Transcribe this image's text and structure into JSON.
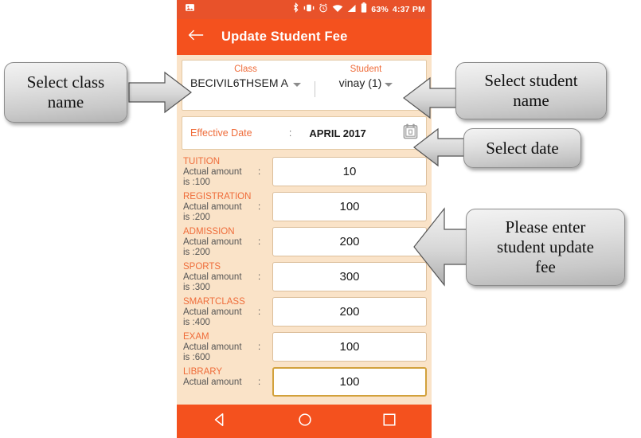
{
  "statusbar": {
    "icons_left": [
      "image-icon"
    ],
    "icons_right": [
      "bluetooth-icon",
      "vibrate-icon",
      "alarm-icon",
      "wifi-icon",
      "signal-icon",
      "battery-icon"
    ],
    "battery_percent": "63%",
    "clock": "4:37 PM"
  },
  "appbar": {
    "back_icon": "back-arrow-icon",
    "title": "Update Student Fee"
  },
  "selector": {
    "class": {
      "label": "Class",
      "value": "BECIVIL6THSEM A",
      "caret": "chevron-down-icon"
    },
    "student": {
      "label": "Student",
      "value": "vinay (1)",
      "caret": "chevron-down-icon"
    }
  },
  "effective_date": {
    "label": "Effective Date",
    "separator": ":",
    "value": "APRIL 2017",
    "icon": "calendar-icon"
  },
  "fees": {
    "actual_label": "Actual amount",
    "separator": ":",
    "rows": [
      {
        "name": "TUITION",
        "actual": "is :100",
        "value": "10",
        "focused": false
      },
      {
        "name": "REGISTRATION",
        "actual": "is :200",
        "value": "100",
        "focused": false
      },
      {
        "name": "ADMISSION",
        "actual": "is :200",
        "value": "200",
        "focused": false
      },
      {
        "name": "SPORTS",
        "actual": "is :300",
        "value": "300",
        "focused": false
      },
      {
        "name": "SMARTCLASS",
        "actual": "is :400",
        "value": "200",
        "focused": false
      },
      {
        "name": "EXAM",
        "actual": "is :600",
        "value": "100",
        "focused": false
      },
      {
        "name": "LIBRARY",
        "actual": "Actual amount",
        "value": "100",
        "focused": true
      }
    ]
  },
  "navbar": {
    "back": "nav-back-icon",
    "home": "nav-home-icon",
    "recents": "nav-recents-icon"
  },
  "callouts": {
    "class": {
      "line1": "Select class",
      "line2": "name"
    },
    "student": {
      "line1": "Select student",
      "line2": "name"
    },
    "date": {
      "line1": "Select date"
    },
    "fee": {
      "line1": "Please enter",
      "line2": "student update",
      "line3": "fee"
    }
  },
  "colors": {
    "status_bar": "#e8522a",
    "app_bar": "#f4511e",
    "screen_bg": "#fae3c8",
    "accent_label": "#ef6c3a",
    "input_border": "#dcbf9c",
    "focus_border": "#d2a13c"
  }
}
